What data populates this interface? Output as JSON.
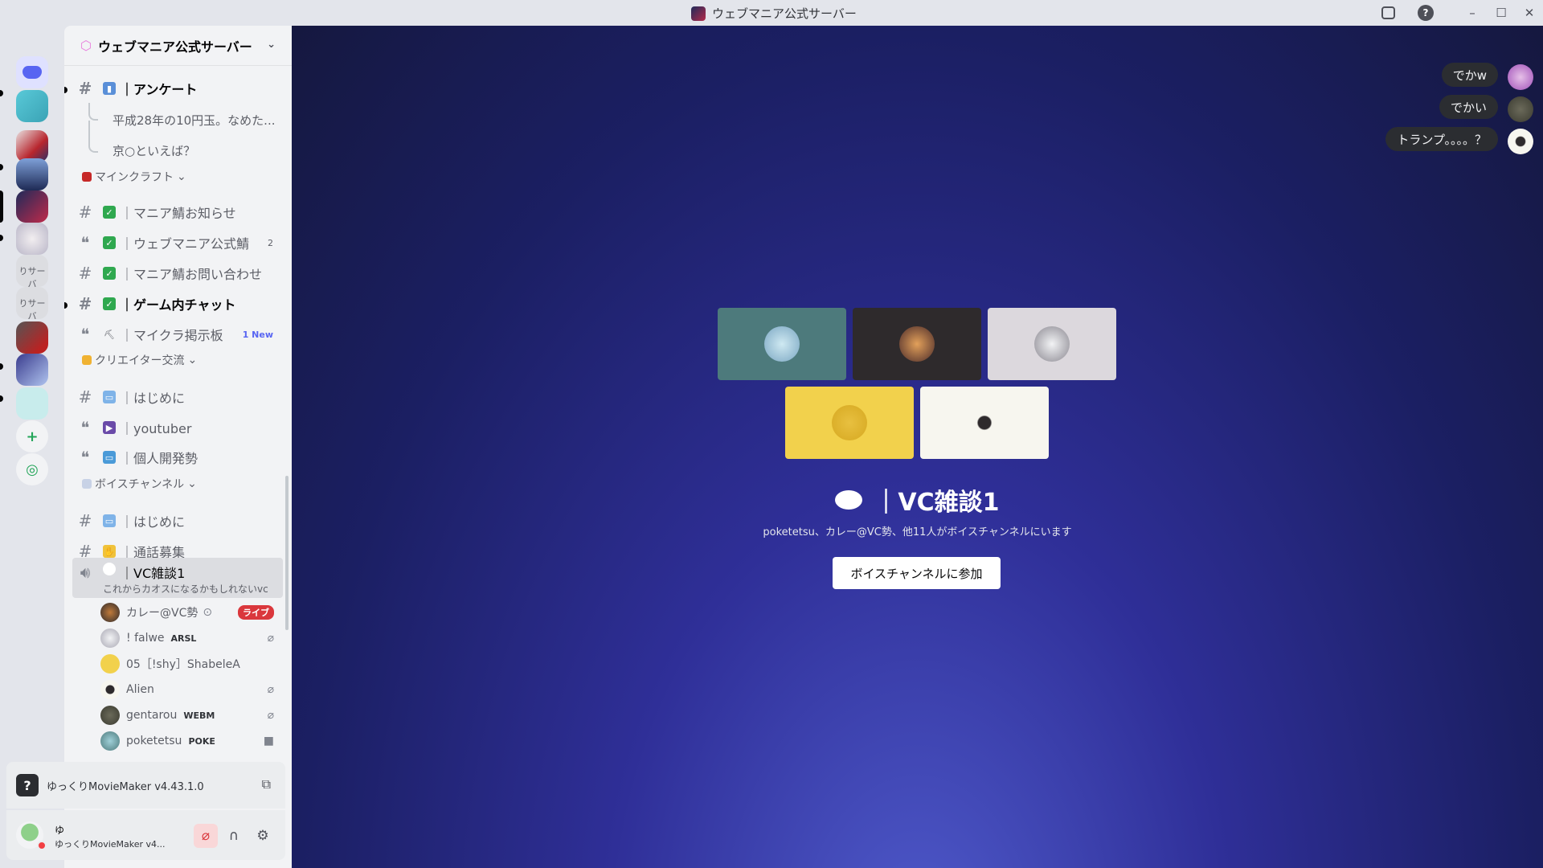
{
  "window": {
    "title": "ウェブマニア公式サーバー"
  },
  "rail": {
    "text_servers": [
      "りサーバ",
      "りサーバ"
    ]
  },
  "sidebar": {
    "guild_name": "ウェブマニア公式サーバー",
    "threads_parent": "｜アンケート",
    "threads": [
      "平成28年の10円玉。なめた...",
      "京○といえば？"
    ],
    "categories": {
      "minecraft": "マインクラフト",
      "creator": "クリエイター交流",
      "voice": "ボイスチャンネル"
    },
    "channels": {
      "mania_news": "｜マニア鯖お知らせ",
      "official_srv": "｜ウェブマニア公式鯖",
      "official_srv_count": "2",
      "inquiry": "｜マニア鯖お問い合わせ",
      "ingame_chat": "｜ゲーム内チャット",
      "board": "｜マイクラ掲示板",
      "board_new": "1 New",
      "intro1": "｜はじめに",
      "youtuber": "｜youtuber",
      "indie": "｜個人開発勢",
      "intro2": "｜はじめに",
      "call_recruit": "｜通話募集",
      "vc1": "｜VC雑談1",
      "vc1_status": "これからカオスになるかもしれないvc"
    },
    "voice_users": [
      {
        "name": "カレー@VC勢",
        "tag": "",
        "right": "ライブ"
      },
      {
        "name": "! falwe",
        "tag": "ARSL",
        "right": "muted"
      },
      {
        "name": "05［!shy］ShabeleA",
        "tag": "",
        "right": ""
      },
      {
        "name": "Alien",
        "tag": "",
        "right": "muted"
      },
      {
        "name": "gentarou",
        "tag": "WEBM",
        "right": "muted"
      },
      {
        "name": "poketetsu",
        "tag": "POKE",
        "right": "camera"
      }
    ]
  },
  "activity": {
    "label": "ゆっくりMovieMaker v4.43.1.0"
  },
  "user": {
    "name": "ゆ",
    "status": "ゆっくりMovieMaker v4..."
  },
  "main": {
    "vc_title": "｜VC雑談1",
    "vc_subtitle": "poketetsu、カレー@VC勢、他11人がボイスチャンネルにいます",
    "join_label": "ボイスチャンネルに参加",
    "messages": [
      "でかw",
      "でかい",
      "トランプ。。。。？"
    ]
  },
  "colors": {
    "accent": "#5865f2",
    "live": "#da373c",
    "tile_teal": "#4d7a7c",
    "tile_dark": "#2e2a2c",
    "tile_gray": "#dcd8dd",
    "tile_yellow": "#f2d14c",
    "tile_cream": "#f7f6ef"
  }
}
